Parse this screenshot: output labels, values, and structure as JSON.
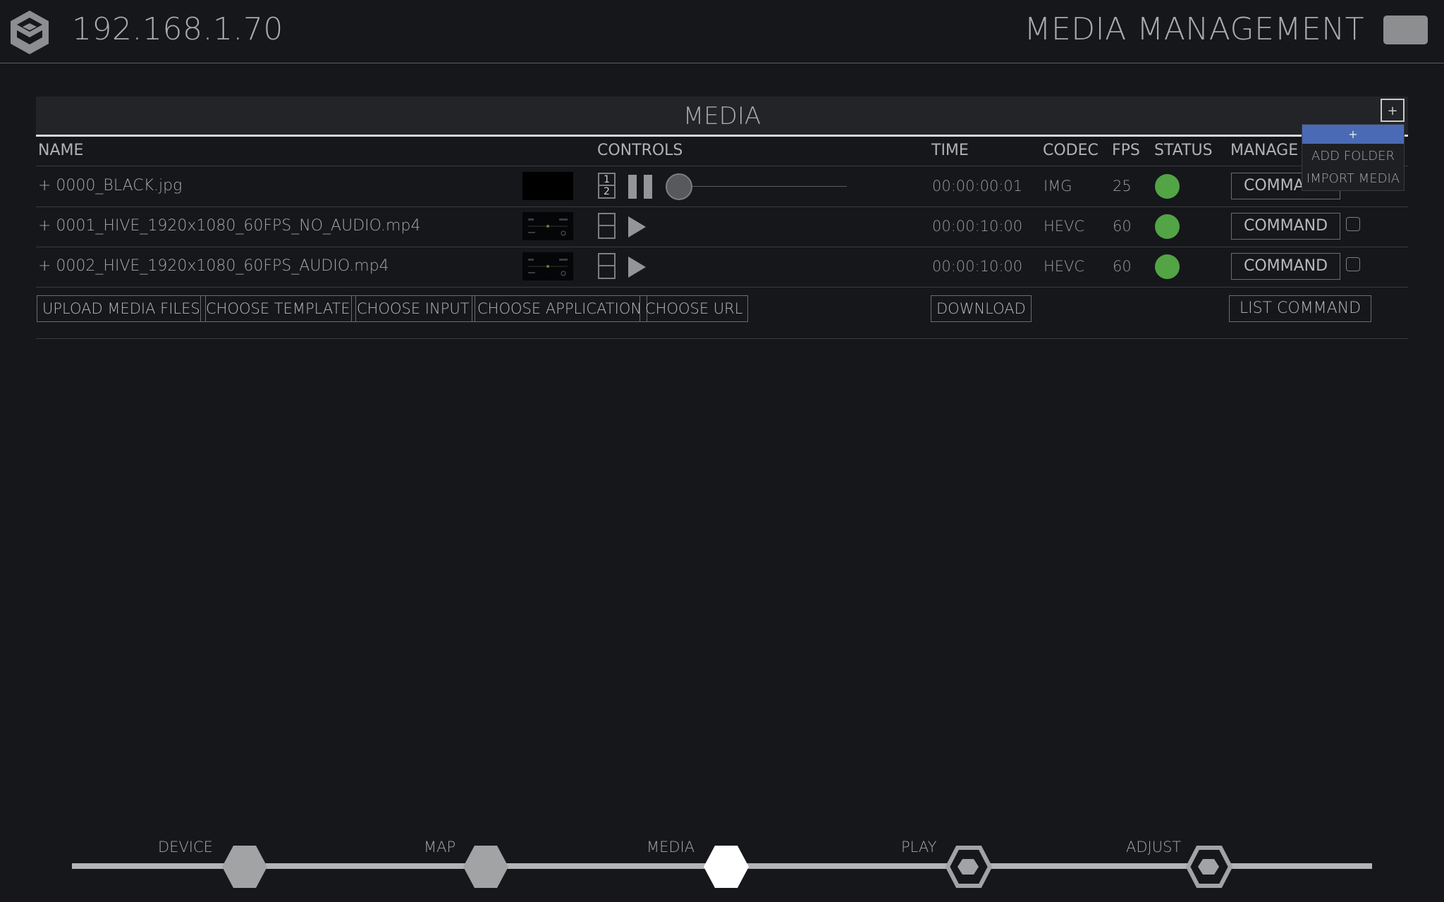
{
  "header": {
    "ip": "192.168.1.70",
    "title": "MEDIA MANAGEMENT"
  },
  "panel": {
    "title": "MEDIA",
    "add_button": "+",
    "columns": {
      "name": "NAME",
      "controls": "CONTROLS",
      "time": "TIME",
      "codec": "CODEC",
      "fps": "FPS",
      "status": "STATUS",
      "manage": "MANAGE"
    },
    "rows": [
      {
        "name": "+ 0000_BLACK.jpg",
        "layer_top": "1",
        "layer_bottom": "2",
        "time": "00:00:00:01",
        "codec": "IMG",
        "fps": "25",
        "status_color": "#53a445",
        "command": "COMMAND"
      },
      {
        "name": "+ 0001_HIVE_1920x1080_60FPS_NO_AUDIO.mp4",
        "time": "00:00:10:00",
        "codec": "HEVC",
        "fps": "60",
        "status_color": "#53a445",
        "command": "COMMAND"
      },
      {
        "name": "+ 0002_HIVE_1920x1080_60FPS_AUDIO.mp4",
        "time": "00:00:10:00",
        "codec": "HEVC",
        "fps": "60",
        "status_color": "#53a445",
        "command": "COMMAND"
      }
    ],
    "actions": {
      "upload": "UPLOAD MEDIA FILES",
      "template": "CHOOSE TEMPLATE",
      "input": "CHOOSE INPUT",
      "application": "CHOOSE APPLICATION",
      "url": "CHOOSE URL",
      "download": "DOWNLOAD",
      "list_command": "LIST COMMAND"
    }
  },
  "dropdown": {
    "header": "+",
    "items": [
      "ADD FOLDER",
      "IMPORT MEDIA"
    ]
  },
  "nav": {
    "items": [
      "DEVICE",
      "MAP",
      "MEDIA",
      "PLAY",
      "ADJUST"
    ],
    "active": "MEDIA"
  },
  "colors": {
    "background": "#16171b",
    "accent": "#4a6ab5",
    "status_ok": "#53a445"
  }
}
